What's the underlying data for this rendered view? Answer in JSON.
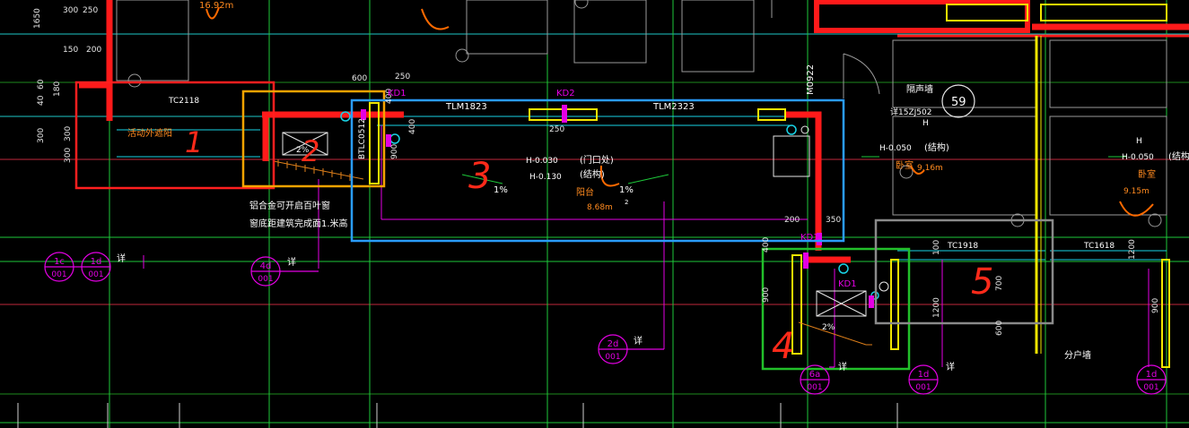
{
  "dims": {
    "d1650": "1650",
    "d300a": "300",
    "d250a": "250",
    "d150": "150",
    "d200": "200",
    "d60": "60",
    "d40": "40",
    "d180": "180",
    "d300b": "300",
    "d300c": "300",
    "d300d": "300",
    "d600": "600",
    "d250b": "250",
    "d400a": "400",
    "d400b": "400",
    "d900a": "900",
    "d250c": "250",
    "d200b": "200",
    "d350": "350",
    "d400c": "400",
    "d900b": "900",
    "d900c": "900",
    "d700": "700",
    "d1200a": "1200",
    "d1200b": "1200",
    "d600b": "600",
    "d100": "100"
  },
  "labels": {
    "area_top": "16.92m",
    "tc2118": "TC2118",
    "sunshade": "活动外遮阳",
    "kd1_a": "KD1",
    "kd2": "KD2",
    "tlm1823": "TLM1823",
    "tlm2323": "TLM2323",
    "m0922": "M0922",
    "btlc0512": "BTLC0512",
    "elev_a": "H-0.030",
    "elev_b": "H-0.130",
    "door_note": "(门口处)",
    "struct_a": "(结构)",
    "slope_a": "1%",
    "slope_b": "1%",
    "slope_c": "2%",
    "slope_d": "2%",
    "balcony": "阳台",
    "balcony_area": "8.68m",
    "sq_a": "2",
    "louver": "铝合金可开启百叶窗",
    "sill": "窗底距建筑完成面1.米高",
    "soundwall": "隔声墙",
    "jzj": "详15ZJ502",
    "n59": "59",
    "elev_c": "H-0.050",
    "struct_b": "(结构)",
    "bedroom_a": "卧室",
    "bedroom_a_area": "9.16m",
    "elev_d": "H-0.050",
    "struct_c": "(结构",
    "bedroom_b": "卧室",
    "bedroom_b_area": "9.15m",
    "h_a": "H",
    "h_b": "H",
    "kd1_b": "KD1",
    "kd1_c": "KD1",
    "tc1918": "TC1918",
    "tc1618": "TC1618",
    "fenhu": "分户墙",
    "xiang": "详"
  },
  "callouts": [
    {
      "top": "1c",
      "bottom": "001"
    },
    {
      "top": "1d",
      "bottom": "001"
    },
    {
      "top": "4d",
      "bottom": "001"
    },
    {
      "top": "2d",
      "bottom": "001"
    },
    {
      "top": "6a",
      "bottom": "001"
    },
    {
      "top": "1d",
      "bottom": "001"
    },
    {
      "top": "1d",
      "bottom": "001"
    }
  ],
  "annotations": {
    "n1": "1",
    "n2": "2",
    "n3": "3",
    "n4": "4",
    "n5": "5"
  },
  "colors": {
    "box1": "#ff1f1f",
    "box2": "#f5a300",
    "box3": "#2a9cff",
    "box4": "#22c02a",
    "box5": "#8a8a8a",
    "wall": "#ff1a1a",
    "window": "#f2e600",
    "annot": "#e6140a"
  }
}
